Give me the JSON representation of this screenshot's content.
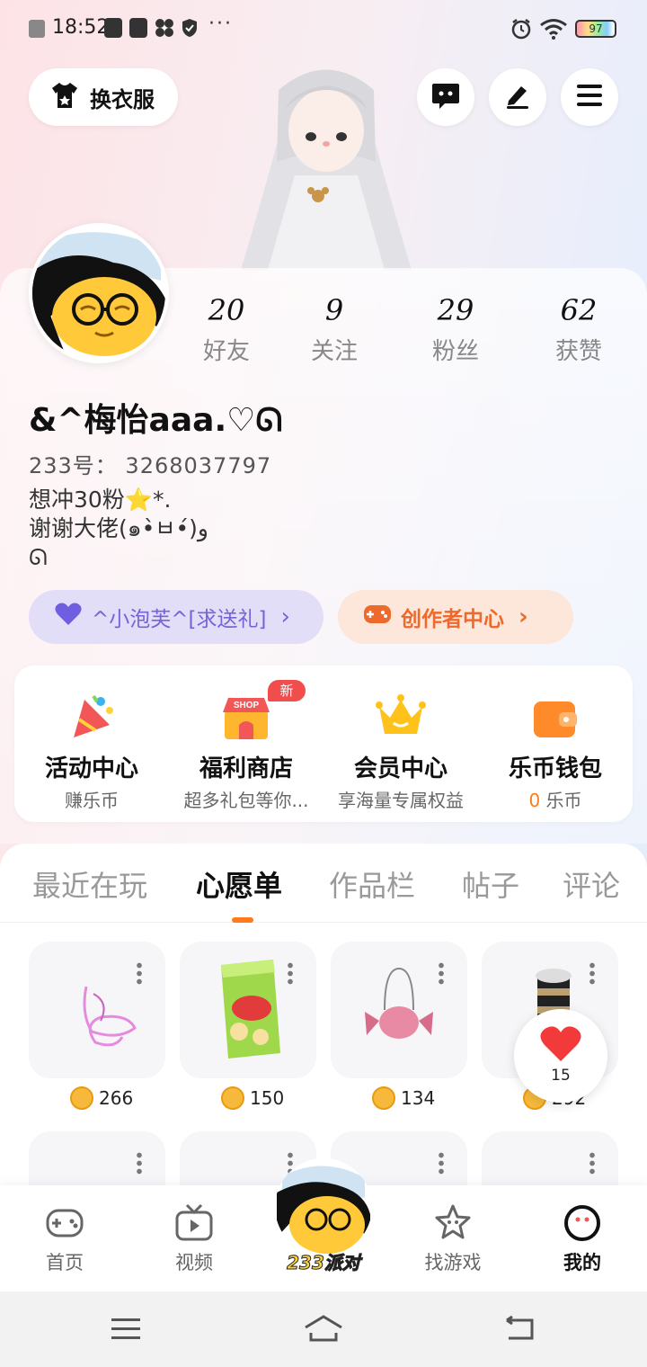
{
  "status_bar": {
    "time": "18:52",
    "more": "···",
    "battery": "97"
  },
  "top_bar": {
    "outfit_label": "换衣服",
    "icons": [
      "chat-icon",
      "edit-icon",
      "menu-icon"
    ]
  },
  "profile": {
    "stats": [
      {
        "value": "20",
        "label": "好友"
      },
      {
        "value": "9",
        "label": "关注"
      },
      {
        "value": "29",
        "label": "粉丝"
      },
      {
        "value": "62",
        "label": "获赞"
      }
    ],
    "nickname": "&^梅怡aaa.♡ᘏ",
    "uid": "233号： 3268037797",
    "bio": "想冲30粉⭐*.\n谢谢大佬(๑•̀ㅂ•́)و\nᘏ",
    "gift_pill": "^小泡芙^[求送礼]",
    "creator_pill": "创作者中心"
  },
  "quick_panel": {
    "items": [
      {
        "title": "活动中心",
        "sub": "赚乐币"
      },
      {
        "title": "福利商店",
        "sub": "超多礼包等你..."
      },
      {
        "title": "会员中心",
        "sub": "享海量专属权益"
      },
      {
        "title": "乐币钱包",
        "sub_value": "0",
        "sub": "乐币"
      }
    ],
    "new_badge": "新",
    "shop_sign": "SHOP"
  },
  "tabs": [
    "最近在玩",
    "心愿单",
    "作品栏",
    "帖子",
    "评论"
  ],
  "active_tab": "心愿单",
  "wishlist": [
    {
      "name": "pink-scribble-item",
      "price": "266"
    },
    {
      "name": "chips-bag-item",
      "price": "150"
    },
    {
      "name": "candy-bag-item",
      "price": "134"
    },
    {
      "name": "striped-hat-item",
      "price": "292"
    }
  ],
  "heart_count": "15",
  "bottom_nav": {
    "items": [
      "首页",
      "视频",
      "233派对",
      "找游戏",
      "我的"
    ],
    "active": "我的"
  },
  "colors": {
    "accent_orange": "#ff7a1a",
    "creator_text": "#ee6a2c",
    "gift_text": "#7464d8",
    "badge_red": "#f24d4d",
    "coin": "#f6b93b"
  }
}
